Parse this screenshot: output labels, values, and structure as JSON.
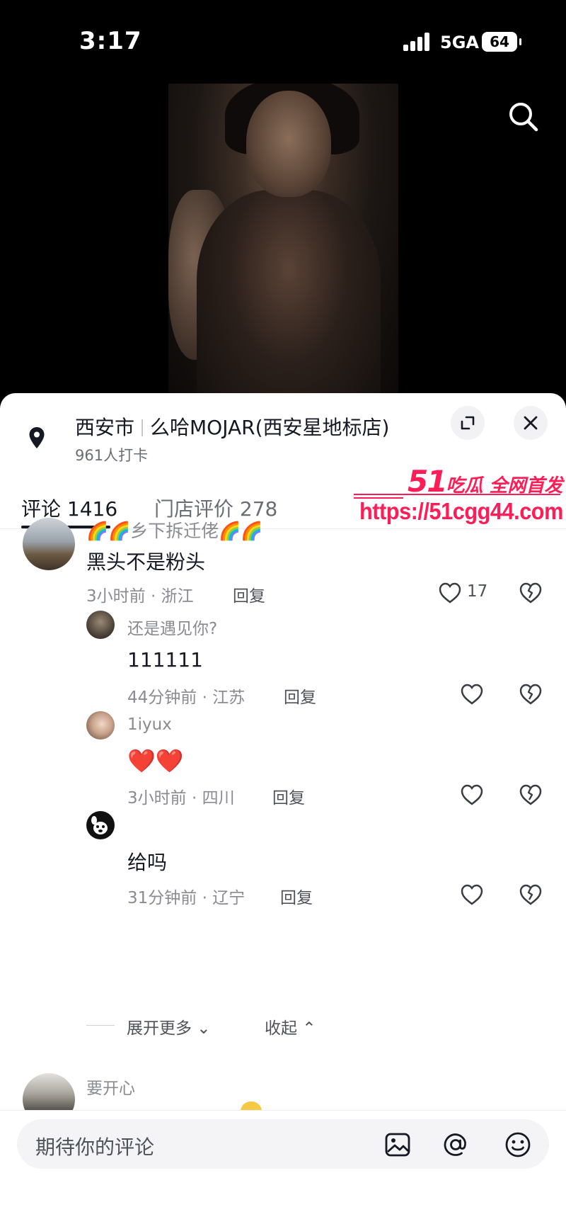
{
  "status_bar": {
    "time": "3:17",
    "network": "5GA",
    "battery": "64"
  },
  "location": {
    "city": "西安市",
    "place": "么哈MOJAR(西安星地标店)",
    "checkins": "961人打卡"
  },
  "tabs": [
    {
      "label": "评论 1416",
      "active": true
    },
    {
      "label": "门店评价 278",
      "active": false
    }
  ],
  "watermark": {
    "brand_num": "51",
    "brand_text": "吃瓜 全网首发",
    "url": "https://51cgg44.com"
  },
  "comments": [
    {
      "nickname": "🌈🌈乡下拆迁佬🌈🌈",
      "text": "黑头不是粉头",
      "meta": "3小时前 · 浙江",
      "reply": "回复",
      "likes": "17"
    },
    {
      "nickname": "还是遇见你?",
      "text": "111111",
      "meta": "44分钟前 · 江苏",
      "reply": "回复",
      "likes": ""
    },
    {
      "nickname": "1iyux",
      "text": "❤️❤️",
      "meta": "3小时前 · 四川",
      "reply": "回复",
      "likes": ""
    },
    {
      "nickname": "",
      "text": "给吗",
      "meta": "31分钟前 · 辽宁",
      "reply": "回复",
      "likes": ""
    },
    {
      "nickname": "要开心",
      "text": "",
      "meta": "",
      "reply": "",
      "likes": ""
    }
  ],
  "thread_controls": {
    "expand_more": "展开更多",
    "collapse": "收起"
  },
  "input": {
    "placeholder": "期待你的评论"
  },
  "colors": {
    "accent_watermark": "#ff1d57",
    "text_primary": "#161823",
    "text_secondary": "#8a8b91"
  }
}
